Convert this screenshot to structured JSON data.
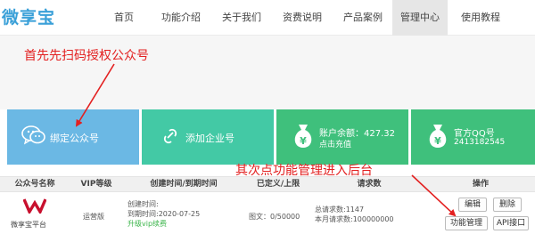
{
  "brand": {
    "logo_text": "微享宝"
  },
  "nav": {
    "items": [
      {
        "label": "首页"
      },
      {
        "label": "功能介绍"
      },
      {
        "label": "关于我们"
      },
      {
        "label": "资费说明"
      },
      {
        "label": "产品案例"
      },
      {
        "label": "管理中心",
        "active": true
      },
      {
        "label": "使用教程"
      }
    ]
  },
  "annotations": {
    "step1": "首先先扫码授权公众号",
    "step2": "其次点功能管理进入后台",
    "color": "#e32020"
  },
  "cards": {
    "bind_public": {
      "label": "绑定公众号",
      "icon": "wechat-icon",
      "color": "#6bb8e4"
    },
    "add_enterprise": {
      "label": "添加企业号",
      "icon": "enterprise-icon",
      "color": "#43c9a5"
    },
    "balance": {
      "label": "账户余额：427.32",
      "sub": "点击充值",
      "icon": "money-bag-icon",
      "color": "#3fc07c"
    },
    "qq": {
      "label": "官方QQ号",
      "sub": "2413182545",
      "icon": "money-bag-icon",
      "color": "#3fc07c"
    }
  },
  "table": {
    "headers": [
      "公众号名称",
      "VIP等级",
      "创建时间/到期时间",
      "已定义/上限",
      "请求数",
      "操作"
    ],
    "row": {
      "account_name": "微享宝平台",
      "vip": "运营版",
      "created": "创建时间:",
      "expires": "到期时间:2020-07-25",
      "upgrade": "升级vip续费",
      "defined": "图文：0/50000",
      "total_requests": "总请求数:1147",
      "month_requests": "本月请求数:100000000",
      "actions": {
        "edit": "编辑",
        "delete": "删除",
        "manage": "功能管理",
        "api": "API接口"
      }
    }
  }
}
